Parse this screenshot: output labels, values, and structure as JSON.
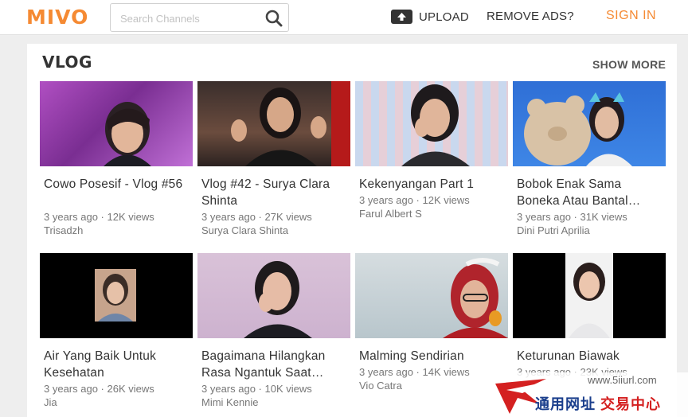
{
  "header": {
    "logo": "MIVO",
    "search_placeholder": "Search Channels",
    "upload_label": "UPLOAD",
    "remove_ads_label": "REMOVE ADS?",
    "sign_in_label": "SIGN IN"
  },
  "section": {
    "title": "VLOG",
    "show_more": "SHOW MORE"
  },
  "videos": [
    {
      "title": "Cowo Posesif - Vlog #56",
      "meta": "3 years ago · 12K views",
      "channel": "Trisadzh"
    },
    {
      "title": "Vlog #42 - Surya Clara Shinta",
      "meta": "3 years ago · 27K views",
      "channel": "Surya Clara Shinta"
    },
    {
      "title": "Kekenyangan Part 1",
      "meta": "3 years ago · 12K views",
      "channel": "Farul Albert S"
    },
    {
      "title": "Bobok Enak Sama Boneka Atau Bantal…",
      "meta": "3 years ago · 31K views",
      "channel": "Dini Putri Aprilia"
    },
    {
      "title": "Air Yang Baik Untuk Kesehatan",
      "meta": "3 years ago · 26K views",
      "channel": "Jia"
    },
    {
      "title": "Bagaimana Hilangkan Rasa Ngantuk Saat…",
      "meta": "3 years ago · 10K views",
      "channel": "Mimi Kennie"
    },
    {
      "title": "Malming Sendirian",
      "meta": "3 years ago · 14K views",
      "channel": "Vio Catra"
    },
    {
      "title": "Keturunan Biawak",
      "meta": "3 years ago · 23K views",
      "channel": ""
    }
  ],
  "watermark": {
    "url": "www.5iiurl.com",
    "cn_left": "通用网址",
    "cn_right": "交易中心"
  },
  "colors": {
    "brand": "#f58a33",
    "text": "#333333",
    "muted": "#777777"
  }
}
